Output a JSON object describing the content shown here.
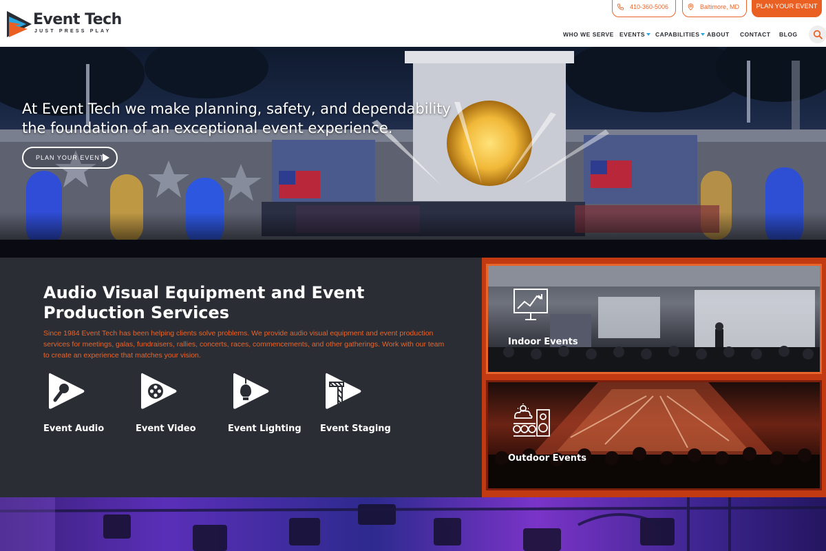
{
  "brand": {
    "name": "Event Tech",
    "tagline": "JUST PRESS PLAY",
    "colors": {
      "accent": "#ea5f22",
      "dark": "#2b2d34",
      "blue": "#2aa6df"
    }
  },
  "contact": {
    "phone": "410-360-5006",
    "location": "Baltimore, MD",
    "cta": "PLAN YOUR EVENT"
  },
  "nav": {
    "items": [
      {
        "label": "WHO WE SERVE",
        "dropdown": false
      },
      {
        "label": "EVENTS",
        "dropdown": true
      },
      {
        "label": "CAPABILITIES",
        "dropdown": true
      },
      {
        "label": "ABOUT",
        "dropdown": false
      },
      {
        "label": "CONTACT",
        "dropdown": false
      },
      {
        "label": "BLOG",
        "dropdown": false
      }
    ],
    "search_icon": "search-icon"
  },
  "hero": {
    "headline": "At Event Tech we make planning, safety, and dependability the foundation of an exceptional event experience.",
    "button": "PLAN YOUR EVENT"
  },
  "services": {
    "title": "Audio Visual Equipment and Event Production Services",
    "description": "Since 1984 Event Tech has been helping clients solve problems. We provide audio visual equipment and event production services for meetings, galas, fundraisers, rallies, concerts, races, commencements, and other gatherings. Work with our team to create an experience that matches your vision.",
    "items": [
      {
        "label": "Event Audio",
        "icon": "microphone-icon"
      },
      {
        "label": "Event Video",
        "icon": "film-reel-icon"
      },
      {
        "label": "Event Lighting",
        "icon": "light-bulb-icon"
      },
      {
        "label": "Event Staging",
        "icon": "truss-icon"
      }
    ]
  },
  "event_types": [
    {
      "label": "Indoor Events",
      "icon": "presentation-board-icon"
    },
    {
      "label": "Outdoor Events",
      "icon": "outdoor-stage-icon"
    }
  ]
}
